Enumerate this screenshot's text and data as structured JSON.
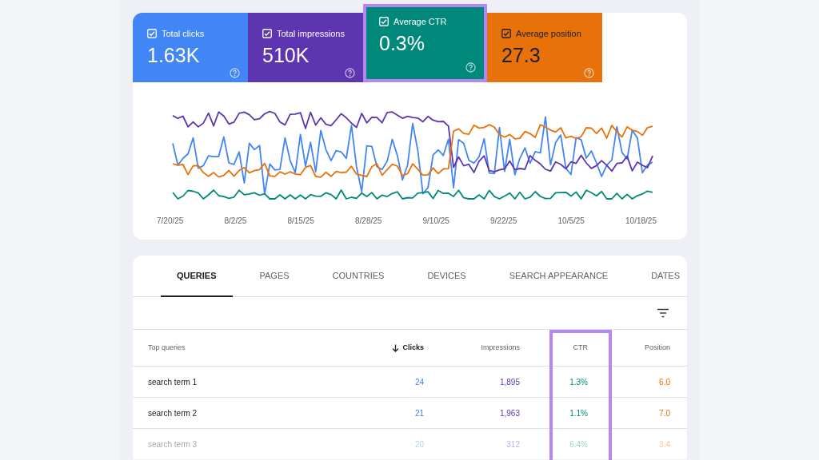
{
  "metrics": [
    {
      "label": "Total clicks",
      "value": "1.63K",
      "color": "#4285f4",
      "checked": true,
      "highlighted": false
    },
    {
      "label": "Total impressions",
      "value": "510K",
      "color": "#5e35b1",
      "checked": true,
      "highlighted": false
    },
    {
      "label": "Average CTR",
      "value": "0.3%",
      "color": "#00897b",
      "checked": true,
      "highlighted": true
    },
    {
      "label": "Average position",
      "value": "27.3",
      "color": "#e8710a",
      "checked": true,
      "highlighted": false
    }
  ],
  "chart": {
    "dates": [
      "7/20/25",
      "8/2/25",
      "8/15/25",
      "8/28/25",
      "9/10/25",
      "9/22/25",
      "10/5/25",
      "10/18/25"
    ]
  },
  "tabs": [
    {
      "label": "QUERIES",
      "selected": true
    },
    {
      "label": "PAGES",
      "selected": false
    },
    {
      "label": "COUNTRIES",
      "selected": false
    },
    {
      "label": "DEVICES",
      "selected": false
    },
    {
      "label": "SEARCH APPEARANCE",
      "selected": false
    },
    {
      "label": "DATES",
      "selected": false
    }
  ],
  "table": {
    "columns": [
      {
        "label": "Top queries",
        "sorted": false,
        "highlighted": false
      },
      {
        "label": "Clicks",
        "sorted": true,
        "highlighted": false
      },
      {
        "label": "Impressions",
        "sorted": false,
        "highlighted": false
      },
      {
        "label": "CTR",
        "sorted": false,
        "highlighted": true
      },
      {
        "label": "Position",
        "sorted": false,
        "highlighted": false
      }
    ],
    "rows": [
      {
        "cells": [
          "search term 1",
          "24",
          "1,895",
          "1.3%",
          "6.0"
        ],
        "faded": false
      },
      {
        "cells": [
          "search term 2",
          "21",
          "1,963",
          "1.1%",
          "7.0"
        ],
        "faded": false
      },
      {
        "cells": [
          "search term 3",
          "20",
          "312",
          "6.4%",
          "3.4"
        ],
        "faded": true
      }
    ]
  }
}
